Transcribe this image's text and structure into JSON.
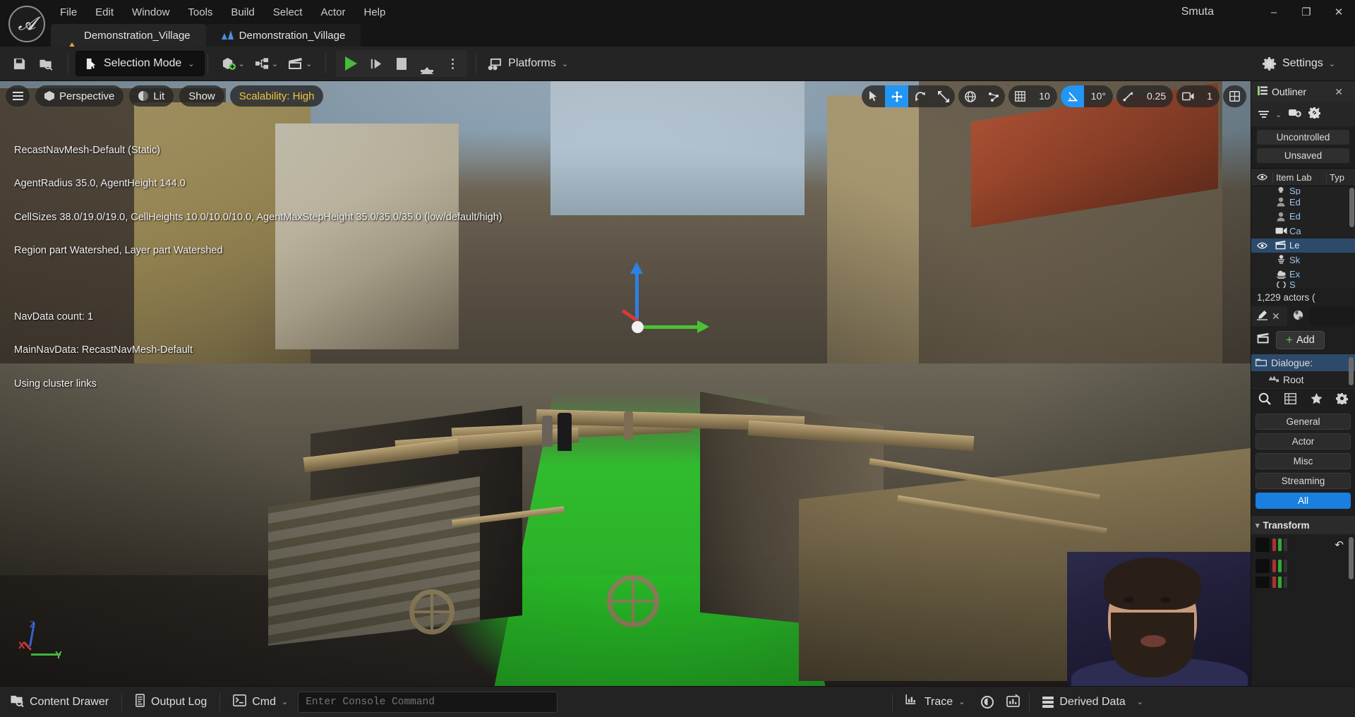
{
  "window": {
    "app_title": "Smuta",
    "minimize_label": "–",
    "maximize_label": "❐",
    "close_label": "✕"
  },
  "menubar": {
    "items": [
      {
        "label": "File"
      },
      {
        "label": "Edit"
      },
      {
        "label": "Window"
      },
      {
        "label": "Tools"
      },
      {
        "label": "Build"
      },
      {
        "label": "Select"
      },
      {
        "label": "Actor"
      },
      {
        "label": "Help"
      }
    ]
  },
  "tabs": [
    {
      "label": "Demonstration_Village",
      "icon": "level-warning-icon",
      "active": true
    },
    {
      "label": "Demonstration_Village",
      "icon": "blueprint-icon",
      "active": false
    }
  ],
  "toolbar": {
    "save_icon": "save-icon",
    "browse_icon": "browse-content-icon",
    "mode_label": "Selection Mode",
    "mode_caret": "⌄",
    "add_caret": "⌄",
    "blueprint_caret": "⌄",
    "cinematics_caret": "⌄",
    "play_label": "Play",
    "skip_label": "Skip",
    "stop_label": "Stop",
    "eject_label": "Eject",
    "options_label": "Play Options",
    "platforms_label": "Platforms",
    "platforms_caret": "⌄",
    "settings_label": "Settings",
    "settings_caret": "⌄"
  },
  "viewport": {
    "menu_icon": "viewport-menu-icon",
    "perspective_label": "Perspective",
    "lit_label": "Lit",
    "show_label": "Show",
    "scalability_label": "Scalability: High",
    "scalability_color": "#f2c43b",
    "tools": {
      "select_icon": "cursor-select-icon",
      "translate_icon": "translate-gizmo-icon",
      "rotate_icon": "rotate-gizmo-icon",
      "scale_icon": "scale-gizmo-icon",
      "world_icon": "world-coordinate-icon",
      "surface_snap_icon": "surface-snap-icon",
      "grid_snap_icon": "grid-snap-icon",
      "grid_snap_value": "10",
      "angle_snap_icon": "angle-snap-icon",
      "angle_snap_value": "10°",
      "scale_snap_icon": "scale-snap-icon",
      "scale_snap_value": "0.25",
      "camera_speed_icon": "camera-speed-icon",
      "camera_speed_value": "1",
      "layout_icon": "viewport-layout-icon",
      "active_tool": "translate",
      "active_snap": "angle",
      "accent_color": "#2196f3"
    },
    "navmesh_overlay": [
      "RecastNavMesh-Default (Static)",
      "AgentRadius 35.0, AgentHeight 144.0",
      "CellSizes 38.0/19.0/19.0, CellHeights 10.0/10.0/10.0, AgentMaxStepHeight 35.0/35.0/35.0 (low/default/high)",
      "Region part Watershed, Layer part Watershed",
      "",
      "NavData count: 1",
      "MainNavData: RecastNavMesh-Default",
      "Using cluster links"
    ],
    "axis_indicator": {
      "x": "X",
      "y": "Y",
      "z": "Z"
    }
  },
  "outliner": {
    "title": "Outliner",
    "close_label": "✕",
    "filter_icon": "filter-icon",
    "filter_caret": "⌄",
    "add_camera_icon": "add-camera-icon",
    "settings_icon": "outliner-settings-icon",
    "chips": [
      {
        "label": "Uncontrolled"
      },
      {
        "label": "Unsaved"
      }
    ],
    "columns": [
      {
        "label": "",
        "icon": "eye-icon"
      },
      {
        "label": "Item Lab"
      },
      {
        "label": "Typ"
      }
    ],
    "rows": [
      {
        "icon": "light-icon",
        "name": "Sp",
        "visible": false,
        "selected": false
      },
      {
        "icon": "pawn-icon",
        "name": "Ed",
        "visible": false,
        "selected": false
      },
      {
        "icon": "pawn-icon",
        "name": "Ed",
        "visible": false,
        "selected": false
      },
      {
        "icon": "camera-icon",
        "name": "Ca",
        "visible": false,
        "selected": false
      },
      {
        "icon": "sequence-icon",
        "name": "Le",
        "visible": true,
        "selected": true
      },
      {
        "icon": "skeleton-icon",
        "name": "Sk",
        "visible": false,
        "selected": false
      },
      {
        "icon": "exponential-fog-icon",
        "name": "Ex",
        "visible": false,
        "selected": false
      },
      {
        "icon": "sphere-icon",
        "name": "S",
        "visible": false,
        "selected": false
      }
    ],
    "actor_count": "1,229 actors ("
  },
  "details": {
    "tabs": [
      {
        "label": "",
        "icon": "details-pencil-icon",
        "active": true,
        "close": "✕"
      },
      {
        "label": "",
        "icon": "world-settings-icon",
        "active": false
      }
    ],
    "sequencer_icon": "sequencer-icon",
    "add_label": "Add",
    "add_plus": "+",
    "tracks": [
      {
        "label": "Dialogue:",
        "icon": "folder-icon",
        "selected": true
      },
      {
        "label": "Root",
        "icon": "transform-track-icon",
        "selected": false
      }
    ],
    "icons": {
      "search": "search-icon",
      "columns": "column-layout-icon",
      "favorites": "star-icon",
      "settings": "gear-icon"
    },
    "categories": [
      {
        "label": "General",
        "active": false
      },
      {
        "label": "Actor",
        "active": false
      },
      {
        "label": "Misc",
        "active": false
      },
      {
        "label": "Streaming",
        "active": false
      },
      {
        "label": "All",
        "active": true
      }
    ],
    "transform_label": "Transform",
    "transform_caret": "▾",
    "undo_icon": "reset-arrow-icon",
    "accent_color": "#1b7fe0"
  },
  "statusbar": {
    "content_drawer_label": "Content Drawer",
    "content_drawer_icon": "content-drawer-icon",
    "output_log_label": "Output Log",
    "output_log_icon": "output-log-icon",
    "cmd_label": "Cmd",
    "cmd_icon": "console-icon",
    "cmd_caret": "⌄",
    "console_placeholder": "Enter Console Command",
    "console_value": "",
    "trace_label": "Trace",
    "trace_icon": "trace-icon",
    "trace_caret": "⌄",
    "perf_icon": "performance-icon",
    "stats_icon": "stats-icon",
    "derived_data_label": "Derived Data",
    "derived_data_icon": "derived-data-icon",
    "derived_data_caret": "⌄"
  }
}
